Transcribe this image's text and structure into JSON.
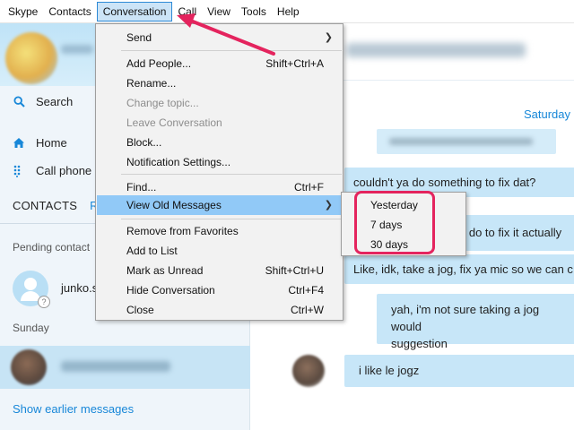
{
  "menubar": {
    "items": [
      "Skype",
      "Contacts",
      "Conversation",
      "Call",
      "View",
      "Tools",
      "Help"
    ],
    "active": "Conversation"
  },
  "sidebar": {
    "search_label": "Search",
    "home_label": "Home",
    "call_phones_label": "Call phone",
    "contacts_label": "CONTACTS",
    "recent_label": "RE",
    "pending_title": "Pending contact",
    "pending_contact_name": "junko.s",
    "pending_badge": "?",
    "day_label": "Sunday",
    "show_earlier": "Show earlier messages"
  },
  "chat": {
    "date_label": "Saturday",
    "messages": [
      "couldn't ya do something to fix dat?",
      "o do to fix it actually",
      "Like, idk, take a jog, fix ya mic so we can c",
      "yah, i'm not sure taking a jog would",
      "suggestion",
      "i like le jogz"
    ]
  },
  "conversation_menu": {
    "items": [
      {
        "label": "Send",
        "shortcut": "",
        "submenu": true,
        "disabled": false
      },
      {
        "label": "Add People...",
        "shortcut": "Shift+Ctrl+A",
        "submenu": false,
        "disabled": false
      },
      {
        "label": "Rename...",
        "shortcut": "",
        "submenu": false,
        "disabled": false
      },
      {
        "label": "Change topic...",
        "shortcut": "",
        "submenu": false,
        "disabled": true
      },
      {
        "label": "Leave Conversation",
        "shortcut": "",
        "submenu": false,
        "disabled": true
      },
      {
        "label": "Block...",
        "shortcut": "",
        "submenu": false,
        "disabled": false
      },
      {
        "label": "Notification Settings...",
        "shortcut": "",
        "submenu": false,
        "disabled": false
      },
      {
        "label": "Find...",
        "shortcut": "Ctrl+F",
        "submenu": false,
        "disabled": false
      },
      {
        "label": "View Old Messages",
        "shortcut": "",
        "submenu": true,
        "disabled": false
      },
      {
        "label": "Remove from Favorites",
        "shortcut": "",
        "submenu": false,
        "disabled": false
      },
      {
        "label": "Add to List",
        "shortcut": "",
        "submenu": false,
        "disabled": false
      },
      {
        "label": "Mark as Unread",
        "shortcut": "Shift+Ctrl+U",
        "submenu": false,
        "disabled": false
      },
      {
        "label": "Hide Conversation",
        "shortcut": "Ctrl+F4",
        "submenu": false,
        "disabled": false
      },
      {
        "label": "Close",
        "shortcut": "Ctrl+W",
        "submenu": false,
        "disabled": false
      }
    ],
    "highlighted": "View Old Messages"
  },
  "view_old_messages_submenu": {
    "items": [
      "Yesterday",
      "7 days",
      "30 days"
    ]
  },
  "colors": {
    "accent": "#1787d8",
    "menu_highlight": "#91c9f7",
    "annotation": "#e4245e",
    "bubble": "#c7e6f8"
  }
}
